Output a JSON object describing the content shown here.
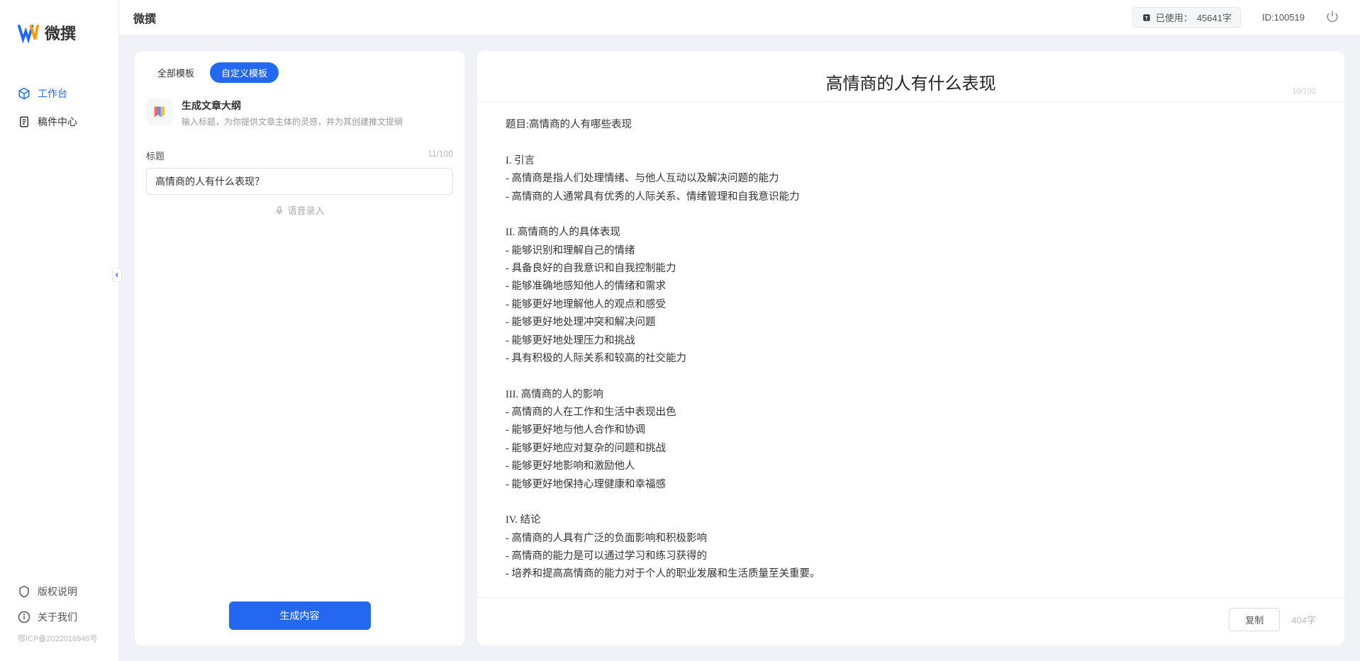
{
  "app": {
    "name": "微撰",
    "logo_text": "微撰"
  },
  "topbar": {
    "title": "微撰",
    "usage_label": "已使用：",
    "usage_value": "45641字",
    "user_id_label": "ID:",
    "user_id": "100519"
  },
  "sidebar": {
    "items": [
      {
        "label": "工作台",
        "icon": "cube-icon",
        "active": true
      },
      {
        "label": "稿件中心",
        "icon": "document-icon",
        "active": false
      }
    ],
    "footer_items": [
      {
        "label": "版权说明",
        "icon": "shield-icon"
      },
      {
        "label": "关于我们",
        "icon": "info-icon"
      }
    ],
    "icp": "鄂ICP备2022016946号"
  },
  "left_panel": {
    "tabs": [
      {
        "label": "全部模板",
        "active": false
      },
      {
        "label": "自定义模板",
        "active": true
      }
    ],
    "template": {
      "title": "生成文章大纲",
      "desc": "输入标题，为你提供文章主体的灵感，并为其创建推文提纲",
      "icon_glyph": "📖"
    },
    "form": {
      "title_label": "标题",
      "title_count": "11/100",
      "title_value": "高情商的人有什么表现？",
      "voice_hint": "语音录入"
    },
    "generate_button": "生成内容"
  },
  "right_panel": {
    "title": "高情商的人有什么表现",
    "header_count": "10/100",
    "body": "题目:高情商的人有哪些表现\n\nI. 引言\n- 高情商是指人们处理情绪、与他人互动以及解决问题的能力\n- 高情商的人通常具有优秀的人际关系、情绪管理和自我意识能力\n\nII. 高情商的人的具体表现\n- 能够识别和理解自己的情绪\n- 具备良好的自我意识和自我控制能力\n- 能够准确地感知他人的情绪和需求\n- 能够更好地理解他人的观点和感受\n- 能够更好地处理冲突和解决问题\n- 能够更好地处理压力和挑战\n- 具有积极的人际关系和较高的社交能力\n\nIII. 高情商的人的影响\n- 高情商的人在工作和生活中表现出色\n- 能够更好地与他人合作和协调\n- 能够更好地应对复杂的问题和挑战\n- 能够更好地影响和激励他人\n- 能够更好地保持心理健康和幸福感\n\nIV. 结论\n- 高情商的人具有广泛的负面影响和积极影响\n- 高情商的能力是可以通过学习和练习获得的\n- 培养和提高高情商的能力对于个人的职业发展和生活质量至关重要。",
    "copy_button": "复制",
    "word_count": "404字"
  }
}
